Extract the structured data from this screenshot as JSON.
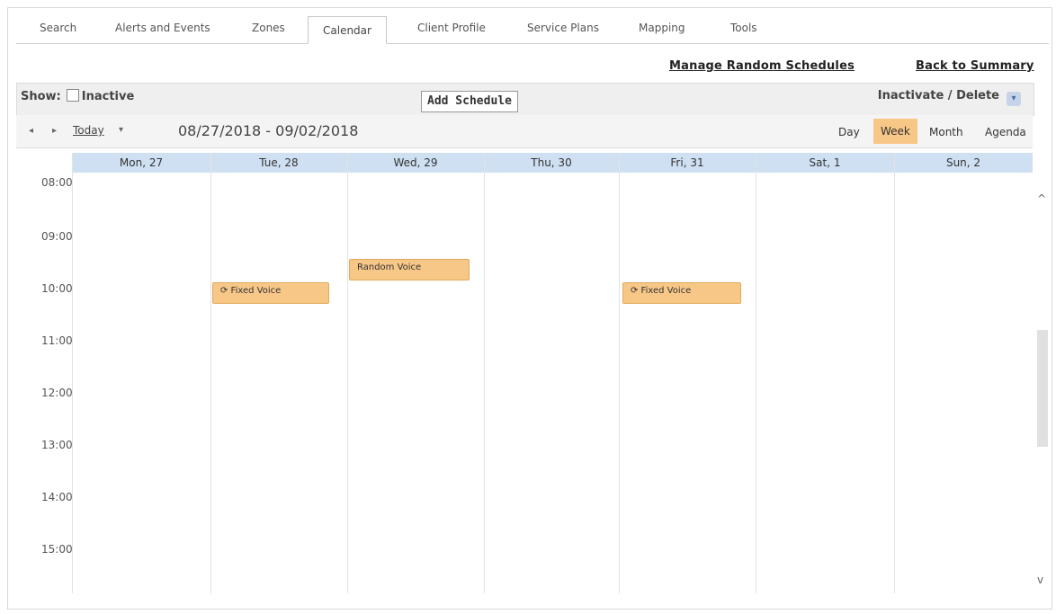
{
  "tabs": [
    "Search",
    "Alerts and Events",
    "Zones",
    "Calendar",
    "Client Profile",
    "Service Plans",
    "Mapping",
    "Tools"
  ],
  "links": {
    "manage_random": "Manage Random Schedules",
    "back_summary": "Back to Summary"
  },
  "toolbar": {
    "show_label": "Show:",
    "inactive_label": "Inactive",
    "add_schedule": "Add Schedule",
    "inactivate_delete": "Inactivate / Delete"
  },
  "nav": {
    "prev": "◂",
    "next": "▸",
    "today": "Today",
    "caret": "▾",
    "date_range": "08/27/2018 - 09/02/2018",
    "views": [
      "Day",
      "Week",
      "Month",
      "Agenda"
    ],
    "active_view": "Week"
  },
  "days": [
    "Mon, 27",
    "Tue, 28",
    "Wed, 29",
    "Thu, 30",
    "Fri, 31",
    "Sat, 1",
    "Sun, 2"
  ],
  "times": [
    "08:00",
    "09:00",
    "10:00",
    "11:00",
    "12:00",
    "13:00",
    "14:00",
    "15:00"
  ],
  "events": [
    {
      "label": "⟳ Fixed Voice",
      "day": "Tue, 28",
      "time": "10:00"
    },
    {
      "label": "Random Voice",
      "day": "Wed, 29",
      "time": "09:30"
    },
    {
      "label": "⟳ Fixed Voice",
      "day": "Fri, 31",
      "time": "10:00"
    }
  ],
  "colors": {
    "event": "#f7c787",
    "day_header": "#cfe0f2",
    "active_view": "#f7c787"
  },
  "icons": {
    "scroll_up": "^",
    "scroll_down": "v",
    "dropdown": "▾"
  }
}
